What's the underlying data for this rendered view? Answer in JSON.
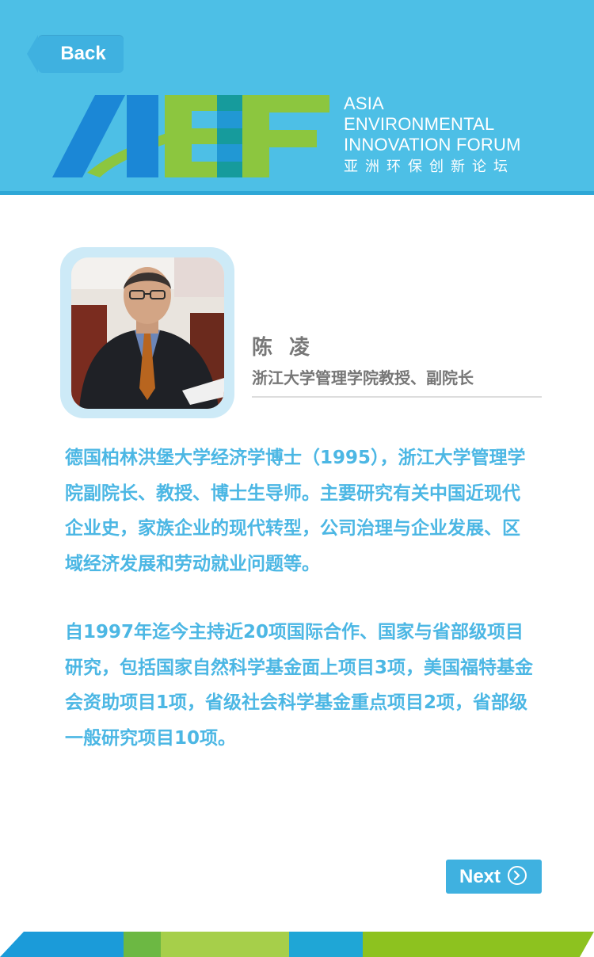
{
  "header": {
    "back_label": "Back",
    "logo": {
      "letters": "AEIF",
      "lines": [
        "ASIA",
        "ENVIRONMENTAL",
        "INNOVATION FORUM"
      ],
      "chinese": "亚洲环保创新论坛"
    },
    "colors": {
      "background": "#4dbfe6",
      "blue": "#1b87d6",
      "green": "#8cc63f"
    }
  },
  "profile": {
    "name": "陈 凌",
    "title": "浙江大学管理学院教授、副院长"
  },
  "bio": {
    "paragraph_1": "德国柏林洪堡大学经济学博士（1995），浙江大学管理学院副院长、教授、博士生导师。主要研究有关中国近现代企业史，家族企业的现代转型，公司治理与企业发展、区域经济发展和劳动就业问题等。",
    "paragraph_2": "自1997年迄今主持近20项国际合作、国家与省部级项目研究，包括国家自然科学基金面上项目3项，美国福特基金会资助项目1项，省级社会科学基金重点项目2项，省部级一般研究项目10项。"
  },
  "footer": {
    "next_label": "Next",
    "next_icon": "chevron-right-circle-icon"
  }
}
